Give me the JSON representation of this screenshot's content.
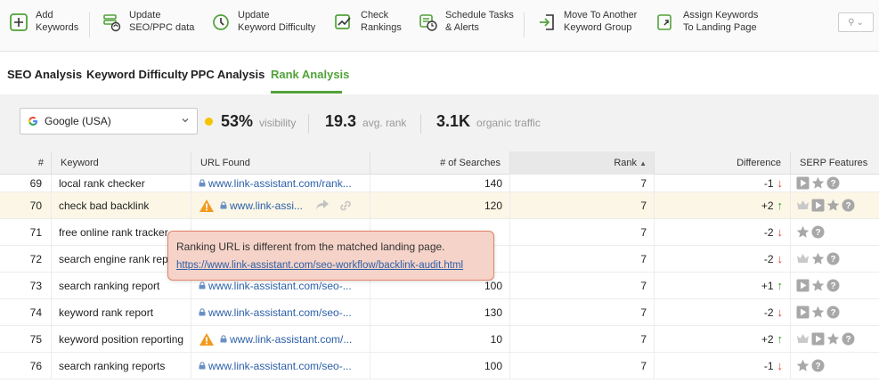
{
  "toolbar": {
    "buttons": [
      {
        "label": "Add\nKeywords",
        "icon": "add-icon"
      },
      {
        "label": "Update\nSEO/PPC data",
        "icon": "update-data-icon"
      },
      {
        "label": "Update\nKeyword Difficulty",
        "icon": "update-difficulty-icon"
      },
      {
        "label": "Check\nRankings",
        "icon": "check-rankings-icon"
      },
      {
        "label": "Schedule Tasks\n& Alerts",
        "icon": "schedule-icon"
      },
      {
        "label": "Move To Another\nKeyword Group",
        "icon": "move-icon"
      },
      {
        "label": "Assign Keywords\nTo Landing Page",
        "icon": "assign-icon"
      }
    ],
    "accent": "#52a23a"
  },
  "tabs": {
    "items": [
      "SEO Analysis",
      "Keyword Difficulty",
      "PPC Analysis",
      "Rank Analysis"
    ],
    "active": "Rank Analysis"
  },
  "summary": {
    "engine": "Google (USA)",
    "visibility_value": "53%",
    "visibility_label": "visibility",
    "avg_rank_value": "19.3",
    "avg_rank_label": "avg. rank",
    "traffic_value": "3.1K",
    "traffic_label": "organic traffic"
  },
  "table": {
    "headers": {
      "num": "#",
      "keyword": "Keyword",
      "url": "URL Found",
      "searches": "# of Searches",
      "rank": "Rank",
      "difference": "Difference",
      "serp": "SERP Features"
    },
    "rows": [
      {
        "num": "69",
        "keyword": "local rank checker",
        "url": "www.link-assistant.com/rank...",
        "warn": false,
        "searches": "140",
        "rank": "7",
        "diff": "-1",
        "dir": "down",
        "serp": [
          "video",
          "star",
          "help"
        ]
      },
      {
        "num": "70",
        "keyword": "check bad backlink",
        "url": "www.link-assi...",
        "warn": true,
        "searches": "120",
        "rank": "7",
        "diff": "+2",
        "dir": "up",
        "serp": [
          "crown",
          "video",
          "star",
          "help"
        ]
      },
      {
        "num": "71",
        "keyword": "free online rank tracker",
        "url": "",
        "warn": false,
        "searches": "",
        "rank": "7",
        "diff": "-2",
        "dir": "down",
        "serp": [
          "star",
          "help"
        ]
      },
      {
        "num": "72",
        "keyword": "search engine rank report",
        "url": "",
        "warn": false,
        "searches": "",
        "rank": "7",
        "diff": "-2",
        "dir": "down",
        "serp": [
          "crown",
          "star",
          "help"
        ]
      },
      {
        "num": "73",
        "keyword": "search ranking report",
        "url": "www.link-assistant.com/seo-...",
        "warn": false,
        "searches": "100",
        "rank": "7",
        "diff": "+1",
        "dir": "up",
        "serp": [
          "video",
          "star",
          "help"
        ]
      },
      {
        "num": "74",
        "keyword": "keyword rank report",
        "url": "www.link-assistant.com/seo-...",
        "warn": false,
        "searches": "130",
        "rank": "7",
        "diff": "-2",
        "dir": "down",
        "serp": [
          "video",
          "star",
          "help"
        ]
      },
      {
        "num": "75",
        "keyword": "keyword position reporting",
        "url": "www.link-assistant.com/...",
        "warn": true,
        "searches": "10",
        "rank": "7",
        "diff": "+2",
        "dir": "up",
        "serp": [
          "crown",
          "video",
          "star",
          "help"
        ]
      },
      {
        "num": "76",
        "keyword": "search ranking reports",
        "url": "www.link-assistant.com/seo-...",
        "warn": false,
        "searches": "100",
        "rank": "7",
        "diff": "-1",
        "dir": "down",
        "serp": [
          "star",
          "help"
        ]
      }
    ]
  },
  "tooltip": {
    "message": "Ranking URL is different from the matched landing page.",
    "link": "https://www.link-assistant.com/seo-workflow/backlink-audit.html"
  }
}
